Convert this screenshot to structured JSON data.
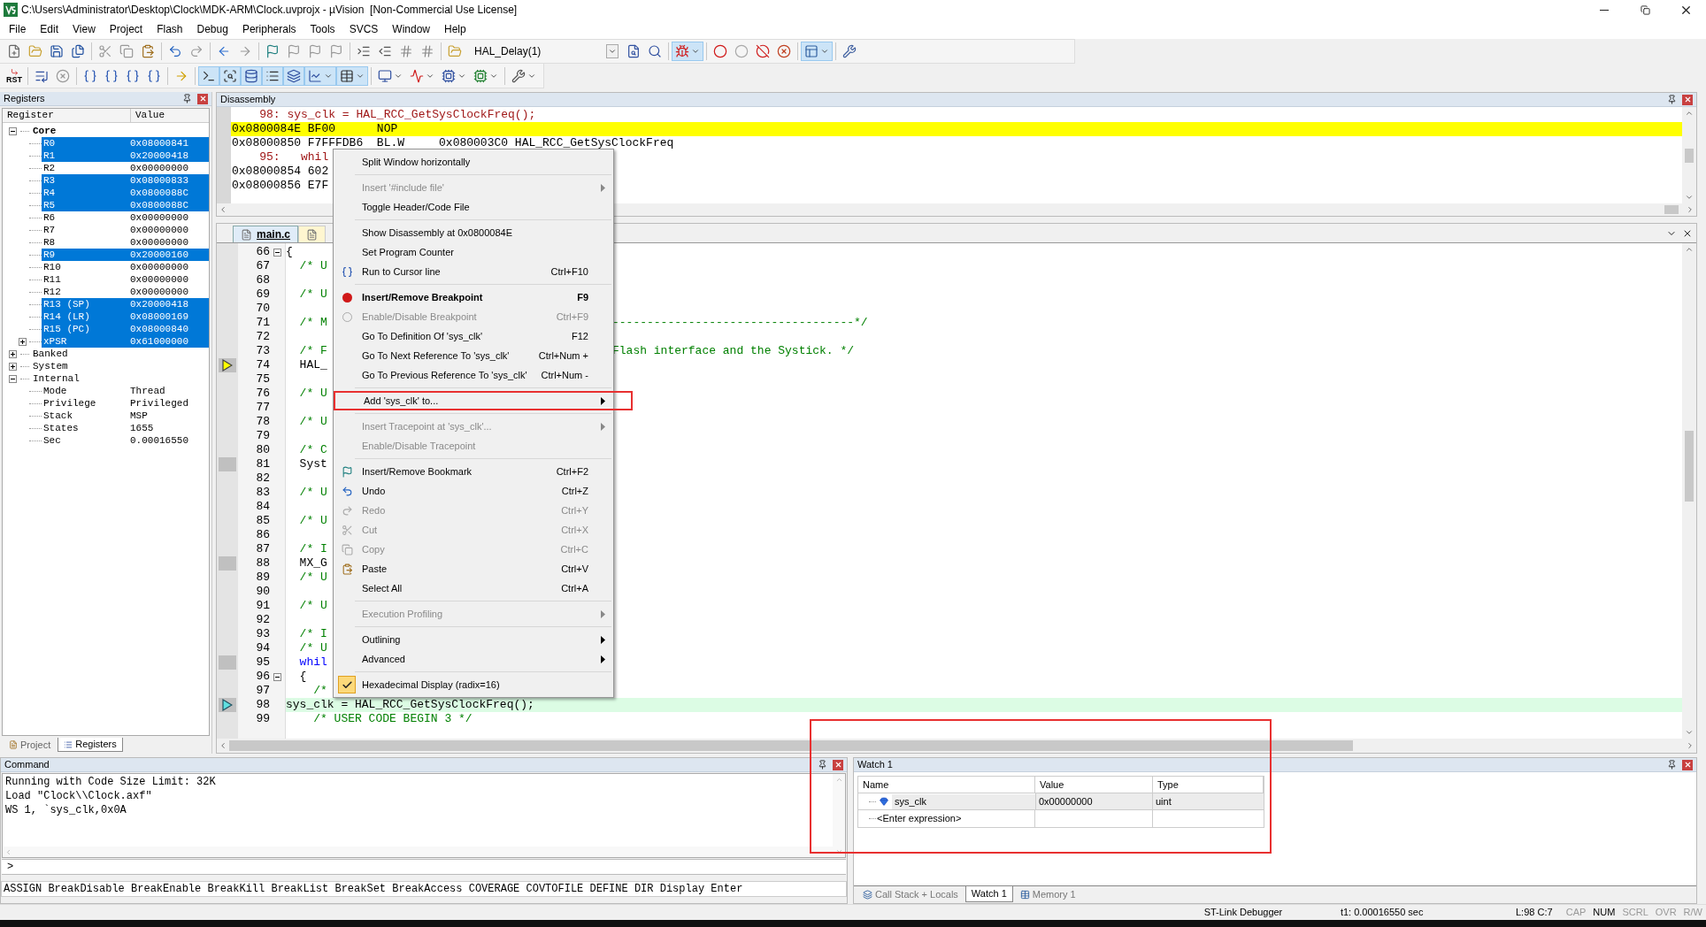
{
  "window": {
    "title": "C:\\Users\\Administrator\\Desktop\\Clock\\MDK-ARM\\Clock.uvprojx - µVision  [Non-Commercial Use License]"
  },
  "menu": [
    "File",
    "Edit",
    "View",
    "Project",
    "Flash",
    "Debug",
    "Peripherals",
    "Tools",
    "SVCS",
    "Window",
    "Help"
  ],
  "toolbar_1": {
    "target": "HAL_Delay(1)",
    "buttons": [
      {
        "pressed": false
      },
      {
        "pressed": false
      },
      {
        "pressed": false
      },
      {
        "pressed": false
      },
      {
        "pressed": false
      },
      {
        "pressed": false
      },
      {
        "pressed": false
      },
      {
        "pressed": false
      },
      {
        "pressed": false
      },
      {
        "pressed": false
      },
      {
        "pressed": false
      },
      {
        "pressed": false
      },
      {
        "pressed": false
      },
      {
        "pressed": false
      },
      {
        "pressed": false
      },
      {
        "pressed": false
      },
      {
        "pressed": false
      },
      {
        "pressed": false
      },
      {
        "pressed": false
      },
      {
        "pressed": false
      },
      {
        "pressed": false
      },
      {
        "pressed": false
      },
      {
        "pressed": true
      },
      {
        "pressed": false
      },
      {
        "pressed": false
      },
      {
        "pressed": false
      },
      {
        "pressed": false
      },
      {
        "pressed": true
      },
      {
        "pressed": false
      }
    ]
  },
  "toolbar_2": {
    "reset_label": "RST",
    "buttons": [
      {
        "pressed": false
      },
      {
        "pressed": false
      },
      {
        "pressed": false
      },
      {
        "pressed": false
      },
      {
        "pressed": false
      },
      {
        "pressed": false
      },
      {
        "pressed": false
      },
      {
        "pressed": true
      },
      {
        "pressed": true
      },
      {
        "pressed": true
      },
      {
        "pressed": true
      },
      {
        "pressed": true
      },
      {
        "pressed": true
      },
      {
        "pressed": true
      },
      {
        "pressed": false
      },
      {
        "pressed": false
      },
      {
        "pressed": false
      },
      {
        "pressed": false
      },
      {
        "pressed": false
      }
    ]
  },
  "registers": {
    "title": "Registers",
    "columns": [
      "Register",
      "Value"
    ],
    "groups": [
      {
        "label": "Core",
        "bold": true,
        "expanded": true,
        "children": [
          {
            "name": "R0",
            "value": "0x08000841",
            "selected": true
          },
          {
            "name": "R1",
            "value": "0x20000418",
            "selected": true
          },
          {
            "name": "R2",
            "value": "0x00000000",
            "selected": false
          },
          {
            "name": "R3",
            "value": "0x08000833",
            "selected": true
          },
          {
            "name": "R4",
            "value": "0x0800088C",
            "selected": true
          },
          {
            "name": "R5",
            "value": "0x0800088C",
            "selected": true
          },
          {
            "name": "R6",
            "value": "0x00000000",
            "selected": false
          },
          {
            "name": "R7",
            "value": "0x00000000",
            "selected": false
          },
          {
            "name": "R8",
            "value": "0x00000000",
            "selected": false
          },
          {
            "name": "R9",
            "value": "0x20000160",
            "selected": true
          },
          {
            "name": "R10",
            "value": "0x00000000",
            "selected": false
          },
          {
            "name": "R11",
            "value": "0x00000000",
            "selected": false
          },
          {
            "name": "R12",
            "value": "0x00000000",
            "selected": false
          },
          {
            "name": "R13 (SP)",
            "value": "0x20000418",
            "selected": true
          },
          {
            "name": "R14 (LR)",
            "value": "0x08000169",
            "selected": true
          },
          {
            "name": "R15 (PC)",
            "value": "0x08000840",
            "selected": true
          },
          {
            "name": "xPSR",
            "value": "0x61000000",
            "selected": true,
            "expanded": false
          }
        ]
      },
      {
        "label": "Banked",
        "bold": false,
        "expanded": false
      },
      {
        "label": "System",
        "bold": false,
        "expanded": false
      },
      {
        "label": "Internal",
        "bold": false,
        "expanded": true,
        "children": [
          {
            "name": "Mode",
            "value": "Thread",
            "selected": false
          },
          {
            "name": "Privilege",
            "value": "Privileged",
            "selected": false
          },
          {
            "name": "Stack",
            "value": "MSP",
            "selected": false
          },
          {
            "name": "States",
            "value": "1655",
            "selected": false
          },
          {
            "name": "Sec",
            "value": "0.00016550",
            "selected": false
          }
        ]
      }
    ],
    "tabs": [
      {
        "label": "Project",
        "selected": false
      },
      {
        "label": "Registers",
        "selected": true
      }
    ]
  },
  "disassembly": {
    "title": "Disassembly",
    "lines": [
      {
        "kind": "source",
        "text": "    98: sys_clk = HAL_RCC_GetSysClockFreq();"
      },
      {
        "kind": "current",
        "text": "0x0800084E BF00      NOP"
      },
      {
        "kind": "asm",
        "text": "0x08000850 F7FFFDB6  BL.W     0x080003C0 HAL_RCC_GetSysClockFreq"
      },
      {
        "kind": "source",
        "text": "    95:   whil"
      },
      {
        "kind": "asm",
        "text": "0x08000854 602"
      },
      {
        "kind": "asm",
        "text": "0x08000856 E7F"
      }
    ]
  },
  "editor": {
    "tabs": [
      {
        "label": "main.c",
        "selected": true
      },
      {
        "selected": false
      }
    ],
    "lines": [
      {
        "number": "66",
        "text": "{",
        "kind": "code",
        "fold": true,
        "executable": false,
        "caller": false,
        "current": false
      },
      {
        "number": "67",
        "text": "  /* U",
        "kind": "comment",
        "executable": false,
        "caller": false,
        "current": false
      },
      {
        "number": "68",
        "executable": false,
        "caller": false,
        "current": false
      },
      {
        "number": "69",
        "text": "  /* U",
        "kind": "comment",
        "executable": false,
        "caller": false,
        "current": false
      },
      {
        "number": "70",
        "executable": false,
        "caller": false,
        "current": false
      },
      {
        "number": "71",
        "text": "  /* M",
        "kind": "comment",
        "text_right": "-----------------------------------*/",
        "executable": false,
        "caller": false,
        "current": false
      },
      {
        "number": "72",
        "executable": false,
        "caller": false,
        "current": false
      },
      {
        "number": "73",
        "text": "  /* F",
        "kind": "comment",
        "text_right": "Flash interface and the Systick. */",
        "executable": false,
        "caller": false,
        "current": false
      },
      {
        "number": "74",
        "text": "  HAL_",
        "kind": "code",
        "executable": true,
        "caller": true,
        "current": false
      },
      {
        "number": "75",
        "executable": false,
        "caller": false,
        "current": false
      },
      {
        "number": "76",
        "text": "  /* U",
        "kind": "comment",
        "executable": false,
        "caller": false,
        "current": false
      },
      {
        "number": "77",
        "executable": false,
        "caller": false,
        "current": false
      },
      {
        "number": "78",
        "text": "  /* U",
        "kind": "comment",
        "executable": false,
        "caller": false,
        "current": false
      },
      {
        "number": "79",
        "executable": false,
        "caller": false,
        "current": false
      },
      {
        "number": "80",
        "text": "  /* C",
        "kind": "comment",
        "executable": false,
        "caller": false,
        "current": false
      },
      {
        "number": "81",
        "text": "  Syst",
        "kind": "code",
        "executable": true,
        "caller": false,
        "current": false
      },
      {
        "number": "82",
        "executable": false,
        "caller": false,
        "current": false
      },
      {
        "number": "83",
        "text": "  /* U",
        "kind": "comment",
        "executable": false,
        "caller": false,
        "current": false
      },
      {
        "number": "84",
        "executable": false,
        "caller": false,
        "current": false
      },
      {
        "number": "85",
        "text": "  /* U",
        "kind": "comment",
        "executable": false,
        "caller": false,
        "current": false
      },
      {
        "number": "86",
        "executable": false,
        "caller": false,
        "current": false
      },
      {
        "number": "87",
        "text": "  /* I",
        "kind": "comment",
        "executable": false,
        "caller": false,
        "current": false
      },
      {
        "number": "88",
        "text": "  MX_G",
        "kind": "code",
        "executable": true,
        "caller": false,
        "current": false
      },
      {
        "number": "89",
        "text": "  /* U",
        "kind": "comment",
        "executable": false,
        "caller": false,
        "current": false
      },
      {
        "number": "90",
        "executable": false,
        "caller": false,
        "current": false
      },
      {
        "number": "91",
        "text": "  /* U",
        "kind": "comment",
        "executable": false,
        "caller": false,
        "current": false
      },
      {
        "number": "92",
        "executable": false,
        "caller": false,
        "current": false
      },
      {
        "number": "93",
        "text": "  /* I",
        "kind": "comment",
        "executable": false,
        "caller": false,
        "current": false
      },
      {
        "number": "94",
        "text": "  /* U",
        "kind": "comment",
        "executable": false,
        "caller": false,
        "current": false
      },
      {
        "number": "95",
        "text": "  whil",
        "kind": "keyword",
        "executable": true,
        "caller": false,
        "current": false
      },
      {
        "number": "96",
        "text": "  {",
        "kind": "code",
        "fold": true,
        "executable": false,
        "caller": false,
        "current": false
      },
      {
        "number": "97",
        "text": "    /*",
        "kind": "comment",
        "executable": false,
        "caller": false,
        "current": false
      },
      {
        "number": "98",
        "text": "sys_clk = HAL_RCC_GetSysClockFreq();",
        "kind": "code",
        "executable": true,
        "caller": false,
        "current": true
      },
      {
        "number": "99",
        "text": "    /* USER CODE BEGIN 3 */",
        "kind": "comment",
        "executable": false,
        "caller": false,
        "current": false
      }
    ]
  },
  "context_menu": [
    {
      "kind": "item",
      "label": "Split Window horizontally"
    },
    {
      "kind": "separator"
    },
    {
      "kind": "item",
      "label": "Insert '#include file'",
      "disabled": true,
      "submenu": true
    },
    {
      "kind": "item",
      "label": "Toggle Header/Code File"
    },
    {
      "kind": "separator"
    },
    {
      "kind": "item",
      "label": "Show Disassembly at 0x0800084E"
    },
    {
      "kind": "item",
      "label": "Set Program Counter"
    },
    {
      "kind": "item",
      "label": "Run to Cursor line",
      "shortcut": "Ctrl+F10"
    },
    {
      "kind": "separator"
    },
    {
      "kind": "item",
      "label": "Insert/Remove Breakpoint",
      "shortcut": "F9",
      "bold": true
    },
    {
      "kind": "item",
      "label": "Enable/Disable Breakpoint",
      "shortcut": "Ctrl+F9",
      "disabled": true
    },
    {
      "kind": "item",
      "label": "Go To Definition Of 'sys_clk'",
      "shortcut": "F12"
    },
    {
      "kind": "item",
      "label": "Go To Next Reference To 'sys_clk'",
      "shortcut": "Ctrl+Num +"
    },
    {
      "kind": "item",
      "label": "Go To Previous Reference To 'sys_clk'",
      "shortcut": "Ctrl+Num -"
    },
    {
      "kind": "separator"
    },
    {
      "kind": "item",
      "label": "Add 'sys_clk' to...",
      "submenu": true,
      "highlighted": true
    },
    {
      "kind": "separator"
    },
    {
      "kind": "item",
      "label": "Insert Tracepoint at 'sys_clk'...",
      "disabled": true,
      "submenu": true
    },
    {
      "kind": "item",
      "label": "Enable/Disable Tracepoint",
      "disabled": true
    },
    {
      "kind": "separator"
    },
    {
      "kind": "item",
      "label": "Insert/Remove Bookmark",
      "shortcut": "Ctrl+F2"
    },
    {
      "kind": "item",
      "label": "Undo",
      "shortcut": "Ctrl+Z"
    },
    {
      "kind": "item",
      "label": "Redo",
      "shortcut": "Ctrl+Y",
      "disabled": true
    },
    {
      "kind": "item",
      "label": "Cut",
      "shortcut": "Ctrl+X",
      "disabled": true
    },
    {
      "kind": "item",
      "label": "Copy",
      "shortcut": "Ctrl+C",
      "disabled": true
    },
    {
      "kind": "item",
      "label": "Paste",
      "shortcut": "Ctrl+V"
    },
    {
      "kind": "item",
      "label": "Select All",
      "shortcut": "Ctrl+A"
    },
    {
      "kind": "separator"
    },
    {
      "kind": "item",
      "label": "Execution Profiling",
      "disabled": true,
      "submenu": true
    },
    {
      "kind": "separator"
    },
    {
      "kind": "item",
      "label": "Outlining",
      "submenu": true
    },
    {
      "kind": "item",
      "label": "Advanced",
      "submenu": true
    },
    {
      "kind": "separator"
    },
    {
      "kind": "item",
      "label": "Hexadecimal Display (radix=16)",
      "checked": true
    }
  ],
  "command": {
    "title": "Command",
    "output": [
      "Running with Code Size Limit: 32K",
      "Load \"Clock\\\\Clock.axf\"",
      "WS 1, `sys_clk,0x0A"
    ],
    "prompt": ">",
    "keywords": "ASSIGN BreakDisable BreakEnable BreakKill BreakList BreakSet BreakAccess COVERAGE COVTOFILE DEFINE DIR Display Enter"
  },
  "watch": {
    "title": "Watch 1",
    "highlighted": true,
    "columns": [
      "Name",
      "Value",
      "Type"
    ],
    "rows": [
      {
        "name": "sys_clk",
        "value": "0x00000000",
        "type": "uint"
      }
    ],
    "placeholder": "<Enter expression>",
    "tabs": [
      {
        "label": "Call Stack + Locals",
        "selected": false
      },
      {
        "label": "Watch 1",
        "selected": true
      },
      {
        "label": "Memory 1",
        "selected": false
      }
    ]
  },
  "status_bar": {
    "debugger": "ST-Link Debugger",
    "time": "t1: 0.00016550 sec",
    "position": "L:98 C:7",
    "indicators": [
      {
        "label": "CAP",
        "on": false
      },
      {
        "label": "NUM",
        "on": true
      },
      {
        "label": "SCRL",
        "on": false
      },
      {
        "label": "OVR",
        "on": false
      },
      {
        "label": "R/W",
        "on": false
      }
    ]
  }
}
